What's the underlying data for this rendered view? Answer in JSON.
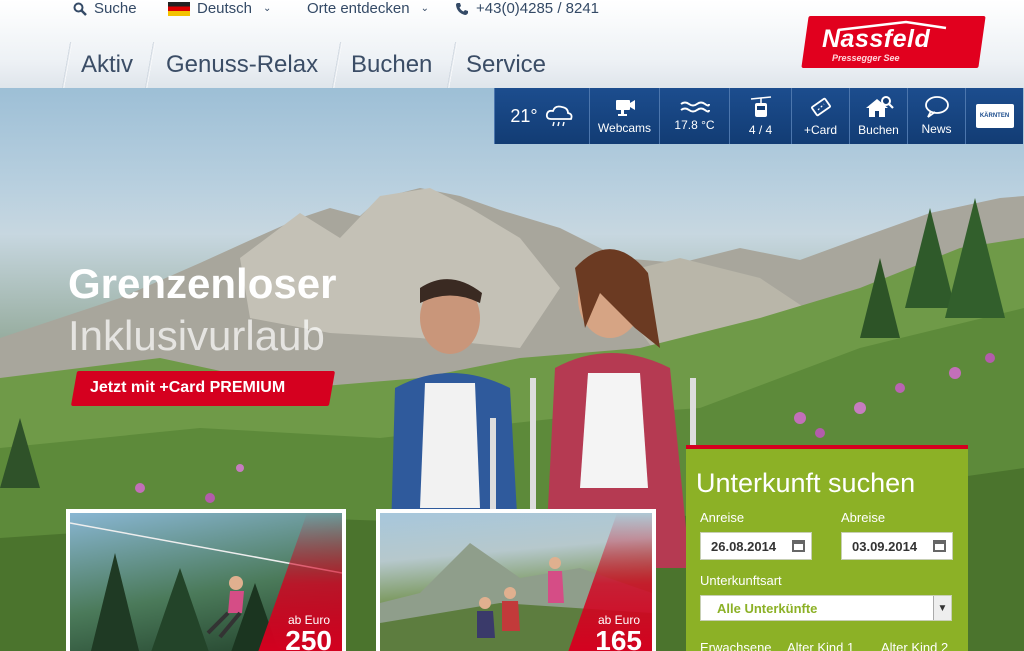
{
  "topbar": {
    "search": "Suche",
    "language": "Deutsch",
    "places": "Orte entdecken",
    "phone": "+43(0)4285 / 8241"
  },
  "nav": [
    "Aktiv",
    "Genuss-Relax",
    "Buchen",
    "Service"
  ],
  "logo": {
    "name": "Nassfeld",
    "sub": "Pressegger See"
  },
  "widgets": {
    "weather_temp": "21°",
    "webcams": "Webcams",
    "water_temp": "17.8 °C",
    "lifts": "4 / 4",
    "card": "+Card",
    "booking": "Buchen",
    "news": "News",
    "karnten_logo": "KÄRNTEN"
  },
  "hero": {
    "headline": "Grenzenloser",
    "subline": "Inklusivurlaub",
    "cta": "Jetzt mit +Card PREMIUM"
  },
  "cards": [
    {
      "price_label": "ab Euro",
      "price": "250"
    },
    {
      "price_label": "ab Euro",
      "price": "165"
    }
  ],
  "booking": {
    "title": "Unterkunft suchen",
    "arrival_label": "Anreise",
    "arrival": "26.08.2014",
    "departure_label": "Abreise",
    "departure": "03.09.2014",
    "type_label": "Unterkunftsart",
    "type_value": "Alle Unterkünfte",
    "adults_label": "Erwachsene",
    "child1_label": "Alter Kind 1",
    "child2_label": "Alter Kind 2"
  },
  "colors": {
    "brand_red": "#e1001e",
    "nav_blue": "#1a4b8c",
    "booking_green": "#8cb126"
  }
}
